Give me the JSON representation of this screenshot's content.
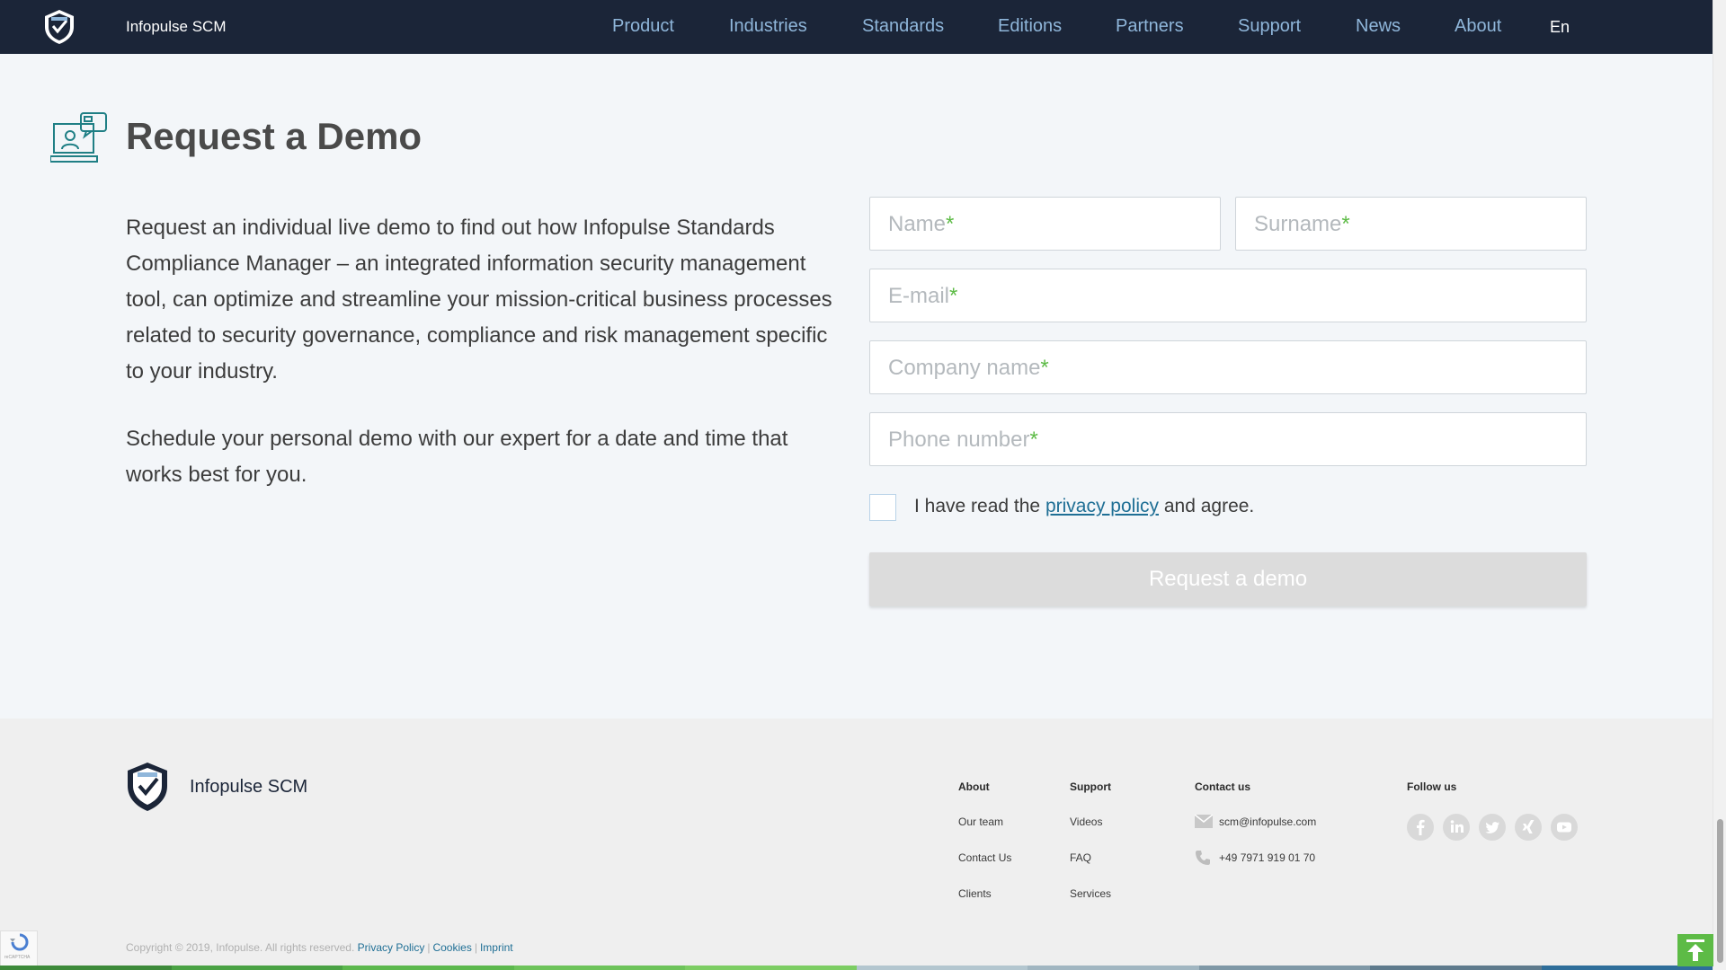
{
  "header": {
    "brand": "Infopulse SCM",
    "nav": [
      "Product",
      "Industries",
      "Standards",
      "Editions",
      "Partners",
      "Support",
      "News",
      "About"
    ],
    "lang": "En",
    "logo_icon": "shield-logo-icon"
  },
  "demo": {
    "title": "Request a Demo",
    "icon": "laptop-support-icon",
    "paragraph1": "Request an individual live demo to find out how Infopulse Standards Compliance Manager – an integrated information security management tool, can optimize and streamline your mission-critical business processes related to security governance, compliance and risk management specific to your industry.",
    "paragraph2": "Schedule your personal demo with our expert for a date and time that works best for you."
  },
  "form": {
    "name_placeholder": "Name",
    "surname_placeholder": "Surname",
    "email_placeholder": "E-mail",
    "company_placeholder": "Company name",
    "phone_placeholder": "Phone number",
    "required_mark": "*",
    "agree_prefix": "I have read the",
    "privacy_link": "privacy policy",
    "agree_suffix": "and agree.",
    "submit_label": "Request a demo"
  },
  "footer": {
    "brand": "Infopulse SCM",
    "about_head": "About",
    "about_links": [
      "Our team",
      "Contact Us",
      "Clients"
    ],
    "support_head": "Support",
    "support_links": [
      "Videos",
      "FAQ",
      "Services"
    ],
    "contact_head": "Contact us",
    "email": "scm@infopulse.com",
    "phone": "+49 7971 919 01 70",
    "follow_head": "Follow us",
    "social": [
      "facebook-icon",
      "linkedin-icon",
      "twitter-icon",
      "xing-icon",
      "youtube-icon"
    ],
    "copyright": "Copyright © 2019, Infopulse. All rights reserved.",
    "legal_links": [
      "Privacy Policy",
      "Cookies",
      "Imprint"
    ],
    "legal_sep": "|",
    "recaptcha": "reCAPTCHA"
  },
  "colors": {
    "header_bg": "#1b2538",
    "nav_link": "#8fb6da",
    "accent_green": "#5dbb46",
    "link_blue": "#1f6f95",
    "strip": [
      "#3d8a3a",
      "#4aa244",
      "#5cb84d",
      "#6dc35a",
      "#7ccd63",
      "#b3c6cf",
      "#a1b6c1",
      "#7f98a6",
      "#5e7a8c",
      "#2f6e9a"
    ]
  }
}
